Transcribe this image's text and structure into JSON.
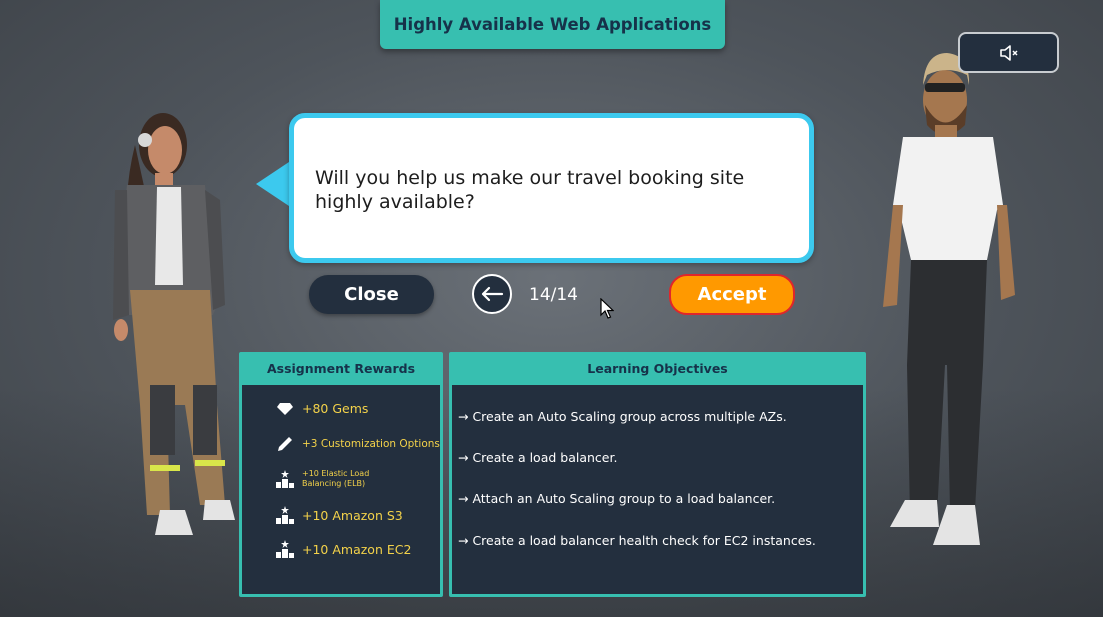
{
  "title": "Highly Available Web Applications",
  "mute_icon": "speaker-muted-icon",
  "dialog": {
    "message": "Will you help us make our travel booking site highly available?"
  },
  "controls": {
    "close_label": "Close",
    "page": "14/14",
    "accept_label": "Accept"
  },
  "rewards": {
    "header": "Assignment Rewards",
    "items": [
      {
        "icon": "gem-icon",
        "text": "+80 Gems"
      },
      {
        "icon": "pencil-icon",
        "text": "+3 Customization Options"
      },
      {
        "icon": "podium-icon",
        "text": "+10 Elastic Load Balancing (ELB)"
      },
      {
        "icon": "podium-icon",
        "text": "+10 Amazon S3"
      },
      {
        "icon": "podium-icon",
        "text": "+10 Amazon EC2"
      }
    ]
  },
  "objectives": {
    "header": "Learning Objectives",
    "items": [
      "→ Create an Auto Scaling group across multiple AZs.",
      "→ Create a load balancer.",
      "→ Attach an Auto Scaling group to a load balancer.",
      "→ Create a load balancer health check for EC2 instances."
    ]
  },
  "colors": {
    "teal": "#37bfb0",
    "navy": "#232f3e",
    "accept": "#ff9900",
    "bubble_border": "#3cc9ee",
    "reward_text": "#f3d24a"
  }
}
